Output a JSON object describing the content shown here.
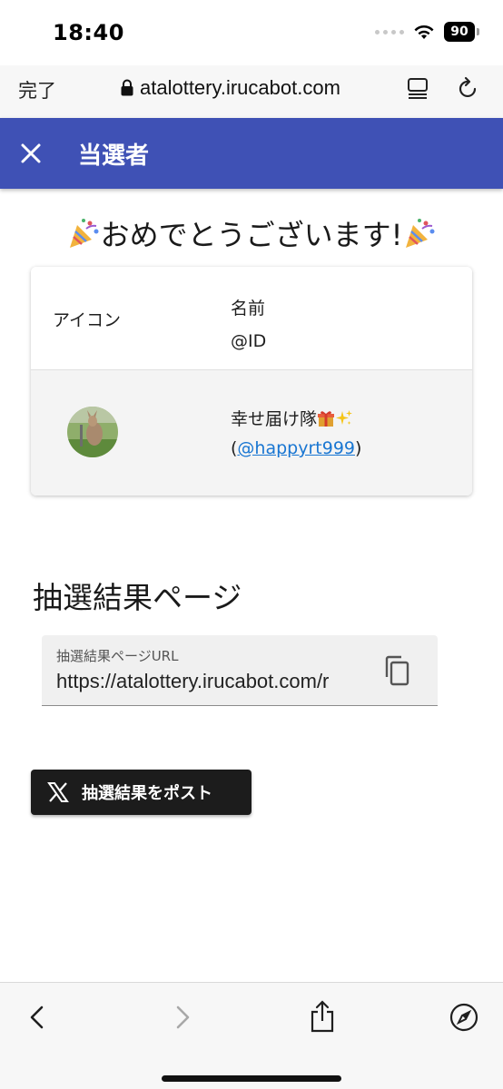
{
  "status_bar": {
    "time": "18:40",
    "battery": "90"
  },
  "browser": {
    "done_label": "完了",
    "url": "atalottery.irucabot.com"
  },
  "app_bar": {
    "title": "当選者",
    "close_icon": "close-icon"
  },
  "congrats": {
    "text": "おめでとうございます!",
    "icon": "party-popper-icon"
  },
  "table": {
    "header_icon": "アイコン",
    "header_name": "名前",
    "header_id": "@ID",
    "rows": [
      {
        "name": "幸せ届け隊",
        "handle": "@happyrt999",
        "name_emojis": [
          "gift-icon",
          "sparkles-icon"
        ]
      }
    ]
  },
  "result_page": {
    "title": "抽選結果ページ",
    "field_label": "抽選結果ページURL",
    "field_value": "https://atalottery.irucabot.com/r"
  },
  "post_button": {
    "label": "抽選結果をポスト",
    "icon": "x-logo-icon"
  },
  "colors": {
    "app_bar": "#3f51b5",
    "link": "#1976d2",
    "post_button": "#1c1c1c"
  }
}
